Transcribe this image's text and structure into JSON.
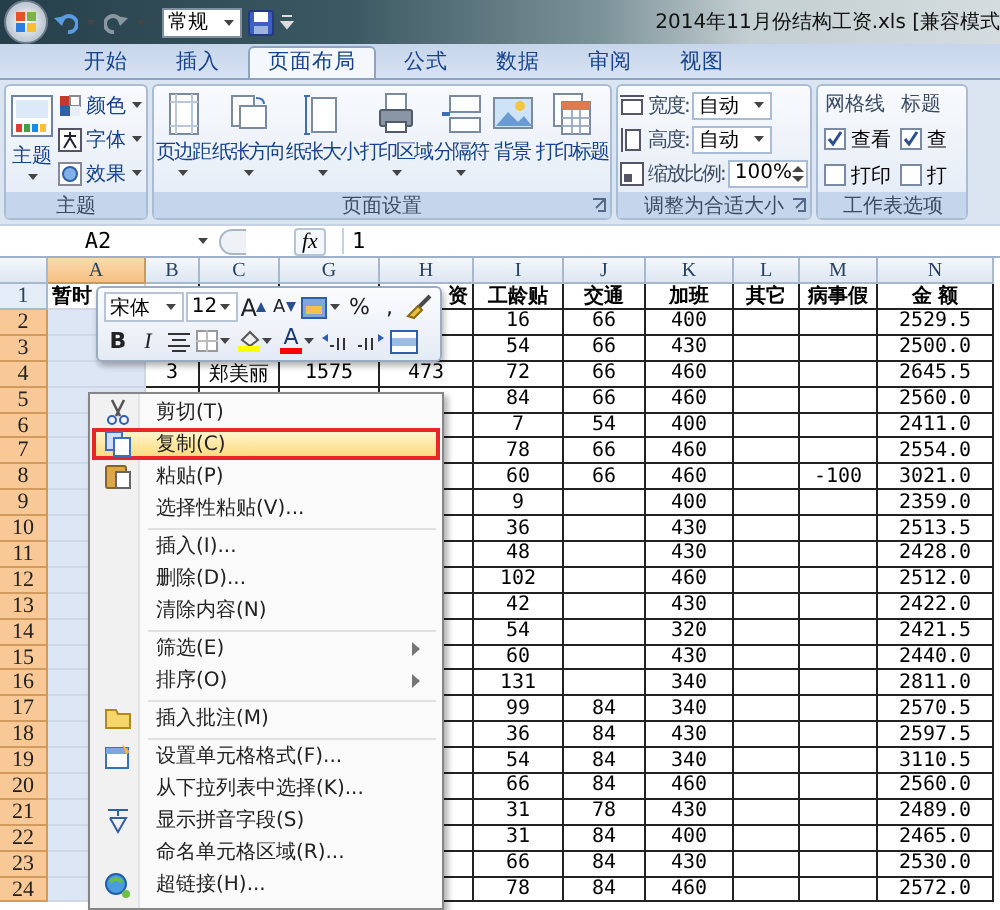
{
  "title_bar": {
    "style_box": "常规",
    "title": "2014年11月份结构工资.xls [兼容模式"
  },
  "tabs": [
    {
      "label": "开始",
      "selected": false
    },
    {
      "label": "插入",
      "selected": false
    },
    {
      "label": "页面布局",
      "selected": true
    },
    {
      "label": "公式",
      "selected": false
    },
    {
      "label": "数据",
      "selected": false
    },
    {
      "label": "审阅",
      "selected": false
    },
    {
      "label": "视图",
      "selected": false
    }
  ],
  "ribbon": {
    "groups": [
      {
        "kind": "theme",
        "title": "主题",
        "launcher": false,
        "big": {
          "label": "主题"
        },
        "items": [
          {
            "label": "颜色"
          },
          {
            "label": "字体"
          },
          {
            "label": "效果"
          }
        ]
      },
      {
        "kind": "buttons",
        "title": "页面设置",
        "launcher": true,
        "buttons": [
          {
            "label": "页边距",
            "dropdown": true
          },
          {
            "label": "纸张方向",
            "dropdown": true
          },
          {
            "label": "纸张大小",
            "dropdown": true
          },
          {
            "label": "打印区域",
            "dropdown": true
          },
          {
            "label": "分隔符",
            "dropdown": true
          },
          {
            "label": "背景",
            "dropdown": false
          },
          {
            "label": "打印标题",
            "dropdown": false
          }
        ]
      },
      {
        "kind": "fields",
        "title": "调整为合适大小",
        "launcher": true,
        "fields": [
          {
            "kind": "dropdown",
            "label": "宽度:",
            "value": "自动"
          },
          {
            "kind": "dropdown",
            "label": "高度:",
            "value": "自动"
          },
          {
            "kind": "spinner",
            "label": "缩放比例:",
            "value": "100%"
          }
        ]
      },
      {
        "kind": "options",
        "title": "工作表选项",
        "launcher": false,
        "columns": [
          {
            "heading": "网格线",
            "options": [
              {
                "label": "查看",
                "checked": true
              },
              {
                "label": "打印",
                "checked": false
              }
            ]
          },
          {
            "heading": "标题",
            "options": [
              {
                "label": "查",
                "checked": true
              },
              {
                "label": "打",
                "checked": false
              }
            ]
          }
        ]
      }
    ]
  },
  "formula_bar": {
    "name_box": "A2",
    "function_label": "fx",
    "formula": "1"
  },
  "sheet": {
    "columns": [
      {
        "label": "A",
        "selected": true
      },
      {
        "label": "B",
        "selected": false
      },
      {
        "label": "C",
        "selected": false
      },
      {
        "label": "G",
        "selected": false
      },
      {
        "label": "H",
        "selected": false
      },
      {
        "label": "I",
        "selected": false
      },
      {
        "label": "J",
        "selected": false
      },
      {
        "label": "K",
        "selected": false
      },
      {
        "label": "L",
        "selected": false
      },
      {
        "label": "M",
        "selected": false
      },
      {
        "label": "N",
        "selected": false
      }
    ],
    "rows": [
      {
        "number": "1",
        "selected": false,
        "cells": {
          "A": "暂时",
          "H": "资",
          "I": "工龄贴",
          "J": "交通",
          "K": "加班",
          "L": "其它",
          "M": "病事假",
          "N": "金 额"
        }
      },
      {
        "number": "2",
        "selected": true,
        "cells": {
          "I": "16",
          "J": "66",
          "K": "400",
          "N": "2529.5"
        }
      },
      {
        "number": "3",
        "selected": true,
        "cells": {
          "I": "54",
          "J": "66",
          "K": "430",
          "N": "2500.0"
        }
      },
      {
        "number": "4",
        "selected": true,
        "cells": {
          "B": "3",
          "C": "郑美丽",
          "G": "1575",
          "H": "473",
          "I": "72",
          "J": "66",
          "K": "460",
          "N": "2645.5"
        }
      },
      {
        "number": "5",
        "selected": true,
        "cells": {
          "I": "84",
          "J": "66",
          "K": "460",
          "N": "2560.0"
        }
      },
      {
        "number": "6",
        "selected": true,
        "cells": {
          "I": "7",
          "J": "54",
          "K": "400",
          "N": "2411.0"
        }
      },
      {
        "number": "7",
        "selected": true,
        "cells": {
          "I": "78",
          "J": "66",
          "K": "460",
          "N": "2554.0"
        }
      },
      {
        "number": "8",
        "selected": true,
        "cells": {
          "I": "60",
          "J": "66",
          "K": "460",
          "M": "-100",
          "N": "3021.0"
        }
      },
      {
        "number": "9",
        "selected": true,
        "cells": {
          "I": "9",
          "K": "400",
          "N": "2359.0"
        }
      },
      {
        "number": "10",
        "selected": true,
        "cells": {
          "I": "36",
          "K": "430",
          "N": "2513.5"
        }
      },
      {
        "number": "11",
        "selected": true,
        "cells": {
          "I": "48",
          "K": "430",
          "N": "2428.0"
        }
      },
      {
        "number": "12",
        "selected": true,
        "cells": {
          "I": "102",
          "K": "460",
          "N": "2512.0"
        }
      },
      {
        "number": "13",
        "selected": true,
        "cells": {
          "I": "42",
          "K": "430",
          "N": "2422.0"
        }
      },
      {
        "number": "14",
        "selected": true,
        "cells": {
          "I": "54",
          "K": "320",
          "N": "2421.5"
        }
      },
      {
        "number": "15",
        "selected": true,
        "cells": {
          "I": "60",
          "K": "430",
          "N": "2440.0"
        }
      },
      {
        "number": "16",
        "selected": true,
        "cells": {
          "I": "131",
          "K": "340",
          "N": "2811.0"
        }
      },
      {
        "number": "17",
        "selected": true,
        "cells": {
          "I": "99",
          "J": "84",
          "K": "340",
          "N": "2570.5"
        }
      },
      {
        "number": "18",
        "selected": true,
        "cells": {
          "I": "36",
          "J": "84",
          "K": "430",
          "N": "2597.5"
        }
      },
      {
        "number": "19",
        "selected": true,
        "cells": {
          "I": "54",
          "J": "84",
          "K": "340",
          "N": "3110.5"
        }
      },
      {
        "number": "20",
        "selected": true,
        "cells": {
          "I": "66",
          "J": "84",
          "K": "460",
          "N": "2560.0"
        }
      },
      {
        "number": "21",
        "selected": true,
        "cells": {
          "I": "31",
          "J": "78",
          "K": "430",
          "N": "2489.0"
        }
      },
      {
        "number": "22",
        "selected": true,
        "cells": {
          "I": "31",
          "J": "84",
          "K": "400",
          "N": "2465.0"
        }
      },
      {
        "number": "23",
        "selected": true,
        "cells": {
          "I": "66",
          "J": "84",
          "K": "430",
          "N": "2530.0"
        }
      },
      {
        "number": "24",
        "selected": true,
        "cells": {
          "I": "78",
          "J": "84",
          "K": "460",
          "N": "2572.0"
        }
      }
    ]
  },
  "mini_toolbar": {
    "font": "宋体",
    "size": "12",
    "top": [
      {
        "kind": "grow",
        "label": "A"
      },
      {
        "kind": "shrink",
        "label": "A"
      },
      {
        "kind": "format"
      },
      {
        "kind": "text",
        "label": "%"
      },
      {
        "kind": "text",
        "label": ","
      },
      {
        "kind": "brush"
      }
    ],
    "bottom": [
      {
        "kind": "bold",
        "label": "B"
      },
      {
        "kind": "italic",
        "label": "I"
      },
      {
        "kind": "center"
      },
      {
        "kind": "border"
      },
      {
        "kind": "fill",
        "color": "#ffff00"
      },
      {
        "kind": "fontcolor",
        "label": "A",
        "color": "#ff0000"
      },
      {
        "kind": "incdec"
      },
      {
        "kind": "decdec"
      },
      {
        "kind": "merge"
      }
    ]
  },
  "context_menu": {
    "items": [
      {
        "label": "剪切(T)",
        "selected": false,
        "separator_before": false,
        "submenu": false
      },
      {
        "label": "复制(C)",
        "selected": true,
        "separator_before": false,
        "submenu": false
      },
      {
        "label": "粘贴(P)",
        "selected": false,
        "separator_before": false,
        "submenu": false
      },
      {
        "label": "选择性粘贴(V)...",
        "selected": false,
        "separator_before": false,
        "submenu": false
      },
      {
        "label": "插入(I)...",
        "selected": false,
        "separator_before": true,
        "submenu": false
      },
      {
        "label": "删除(D)...",
        "selected": false,
        "separator_before": false,
        "submenu": false
      },
      {
        "label": "清除内容(N)",
        "selected": false,
        "separator_before": false,
        "submenu": false
      },
      {
        "label": "筛选(E)",
        "selected": false,
        "separator_before": true,
        "submenu": true
      },
      {
        "label": "排序(O)",
        "selected": false,
        "separator_before": false,
        "submenu": true
      },
      {
        "label": "插入批注(M)",
        "selected": false,
        "separator_before": true,
        "submenu": false
      },
      {
        "label": "设置单元格格式(F)...",
        "selected": false,
        "separator_before": true,
        "submenu": false
      },
      {
        "label": "从下拉列表中选择(K)...",
        "selected": false,
        "separator_before": false,
        "submenu": false
      },
      {
        "label": "显示拼音字段(S)",
        "selected": false,
        "separator_before": false,
        "submenu": false
      },
      {
        "label": "命名单元格区域(R)...",
        "selected": false,
        "separator_before": false,
        "submenu": false
      },
      {
        "label": "超链接(H)...",
        "selected": false,
        "separator_before": false,
        "submenu": false
      }
    ]
  }
}
